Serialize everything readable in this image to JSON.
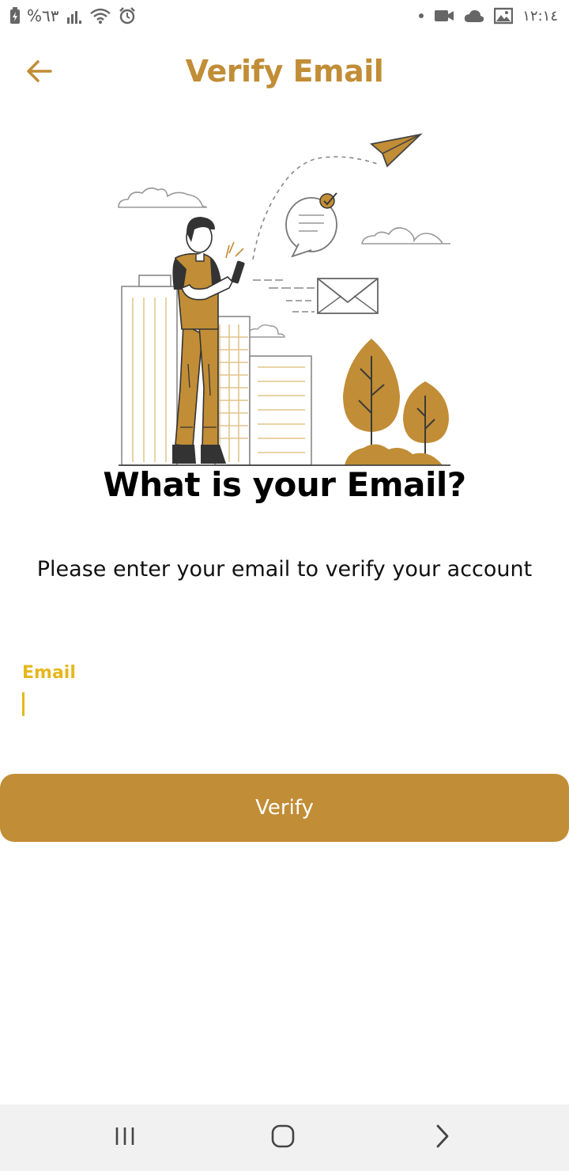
{
  "status_bar": {
    "battery": "%٦٣",
    "time": "١٢:١٤"
  },
  "app_bar": {
    "title": "Verify Email"
  },
  "content": {
    "heading": "What is your Email?",
    "description": "Please enter your email to verify your account"
  },
  "form": {
    "email_label": "Email",
    "email_value": ""
  },
  "actions": {
    "verify_label": "Verify"
  },
  "colors": {
    "accent": "#C18D36",
    "label_yellow": "#E6B81E",
    "nav_bg": "#f1f1f1"
  },
  "icons": {
    "back": "arrow-left-icon",
    "recent_apps": "recent-apps-icon",
    "home": "home-icon",
    "back_nav": "chevron-right-icon"
  }
}
